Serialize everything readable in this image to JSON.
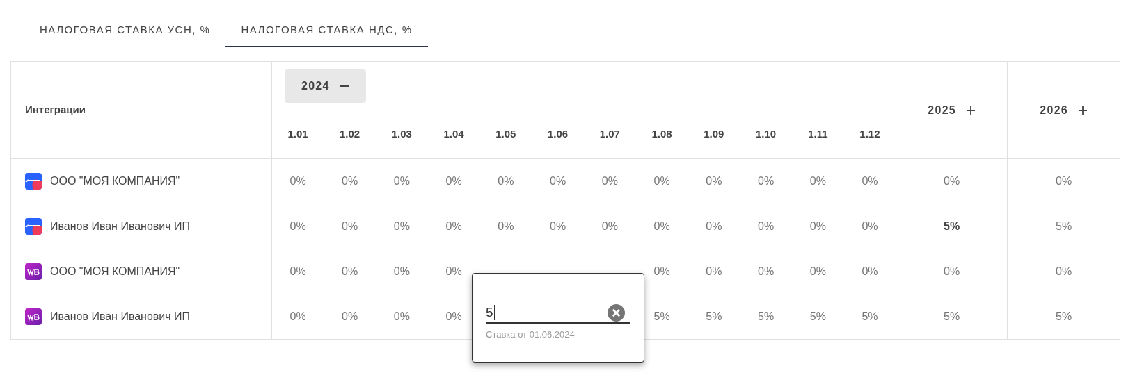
{
  "tabs": [
    {
      "label": "НАЛОГОВАЯ СТАВКА УСН, %",
      "selected": false
    },
    {
      "label": "НАЛОГОВАЯ СТАВКА НДС, %",
      "selected": true
    }
  ],
  "table": {
    "first_column": "Интеграции",
    "years": [
      {
        "label": "2024",
        "expanded": true
      },
      {
        "label": "2025",
        "expanded": false
      },
      {
        "label": "2026",
        "expanded": false
      }
    ],
    "months": [
      "1.01",
      "1.02",
      "1.03",
      "1.04",
      "1.05",
      "1.06",
      "1.07",
      "1.08",
      "1.09",
      "1.10",
      "1.11",
      "1.12"
    ],
    "rows": [
      {
        "kind": "ozon",
        "name": "ООО \"МОЯ КОМПАНИЯ\"",
        "covered": false,
        "months": [
          "0%",
          "0%",
          "0%",
          "0%",
          "0%",
          "0%",
          "0%",
          "0%",
          "0%",
          "0%",
          "0%",
          "0%"
        ],
        "years": [
          {
            "text": "0%",
            "changed": false
          },
          {
            "text": "0%",
            "changed": false
          }
        ]
      },
      {
        "kind": "ozon",
        "name": "Иванов Иван Иванович ИП",
        "covered": false,
        "months": [
          "0%",
          "0%",
          "0%",
          "0%",
          "0%",
          "0%",
          "0%",
          "0%",
          "0%",
          "0%",
          "0%",
          "0%"
        ],
        "years": [
          {
            "text": "5%",
            "changed": true
          },
          {
            "text": "5%",
            "changed": false
          }
        ]
      },
      {
        "kind": "wb",
        "name": "ООО \"МОЯ КОМПАНИЯ\"",
        "covered": true,
        "months": [
          "0%",
          "0%",
          "0%",
          "0%",
          "0%",
          "0%",
          "0%",
          "0%",
          "0%"
        ],
        "years": [
          {
            "text": "0%",
            "changed": false
          },
          {
            "text": "0%",
            "changed": false
          }
        ]
      },
      {
        "kind": "wb",
        "name": "Иванов Иван Иванович ИП",
        "covered": true,
        "months": [
          "0%",
          "0%",
          "0%",
          "0%",
          "5%",
          "5%",
          "5%",
          "5%",
          "5%"
        ],
        "years": [
          {
            "text": "5%",
            "changed": false
          },
          {
            "text": "5%",
            "changed": false
          }
        ]
      }
    ]
  },
  "popup": {
    "value": "5",
    "hint": "Ставка от 01.06.2024"
  }
}
